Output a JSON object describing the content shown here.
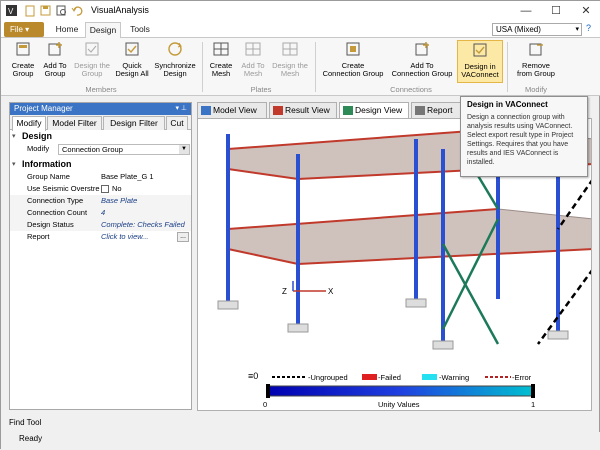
{
  "window": {
    "title": "VisualAnalysis",
    "controls": [
      "minimize",
      "maximize",
      "close"
    ]
  },
  "ribbon": {
    "file_label": "File ▾",
    "tabs": [
      "Home",
      "Design",
      "Tools"
    ],
    "active_tab": "Design",
    "units": "USA (Mixed)",
    "groups": {
      "members": {
        "label": "Members",
        "buttons": [
          {
            "l1": "Create",
            "l2": "Group"
          },
          {
            "l1": "Add To",
            "l2": "Group"
          },
          {
            "l1": "Design the",
            "l2": "Group"
          },
          {
            "l1": "Quick",
            "l2": "Design All"
          },
          {
            "l1": "Synchronize",
            "l2": "Design"
          }
        ]
      },
      "plates": {
        "label": "Plates",
        "buttons": [
          {
            "l1": "Create",
            "l2": "Mesh"
          },
          {
            "l1": "Add To",
            "l2": "Mesh"
          },
          {
            "l1": "Design the",
            "l2": "Mesh"
          }
        ]
      },
      "connections": {
        "label": "Connections",
        "buttons": [
          {
            "l1": "Create",
            "l2": "Connection Group"
          },
          {
            "l1": "Add To",
            "l2": "Connection Group"
          },
          {
            "l1": "Design in",
            "l2": "VAConnect"
          }
        ]
      },
      "modify": {
        "label": "Modify",
        "buttons": [
          {
            "l1": "Remove",
            "l2": "from Group"
          }
        ]
      }
    }
  },
  "project_manager": {
    "title": "Project Manager",
    "pin": "▾ ⊥",
    "tabs": [
      "Modify",
      "Model Filter",
      "Design Filter",
      "Cut"
    ],
    "design_section": "Design",
    "modify_label": "Modify",
    "modify_value": "Connection Group",
    "info_section": "Information",
    "props": [
      {
        "k": "Group Name",
        "v": "Base Plate_G 1",
        "style": ""
      },
      {
        "k": "Use Seismic Overstre",
        "v": "No",
        "style": "chk"
      },
      {
        "k": "Connection Type",
        "v": "Base Plate",
        "style": "it"
      },
      {
        "k": "Connection Count",
        "v": "4",
        "style": "it"
      },
      {
        "k": "Design Status",
        "v": "Complete: Checks Failed",
        "style": "it"
      },
      {
        "k": "Report",
        "v": "Click to view...",
        "style": "it"
      }
    ],
    "ellipsis": "..."
  },
  "view_tabs": [
    "Model View",
    "Result View",
    "Design View",
    "Report"
  ],
  "active_view": "Design View",
  "tooltip": {
    "title": "Design in VAConnect",
    "body": "Design a connection group with analysis results using VAConnect. Select export result type in Project Settings. Requires that you have results and IES VAConnect is installed."
  },
  "legend": {
    "items": [
      {
        "label": "-Ungrouped",
        "color": "#000000",
        "style": "dashed"
      },
      {
        "label": "-Failed",
        "color": "#e02020",
        "style": "solid"
      },
      {
        "label": "-Warning",
        "color": "#25e0f0",
        "style": "solid"
      },
      {
        "label": "-Error",
        "color": "#b22222",
        "style": "dashed"
      }
    ],
    "scale_min": "0",
    "scale_max": "1",
    "scale_title": "Unity Values"
  },
  "axes": {
    "x": "X",
    "z": "Z"
  },
  "colors": {
    "accent": "#3b74c4",
    "file_tab": "#b9892c",
    "column": "#2a4fd0",
    "beam_red": "#c0392b",
    "brace_green": "#1c7a5a",
    "slab": "#c9b9b4"
  },
  "find_tool": "Find Tool",
  "status": "Ready"
}
